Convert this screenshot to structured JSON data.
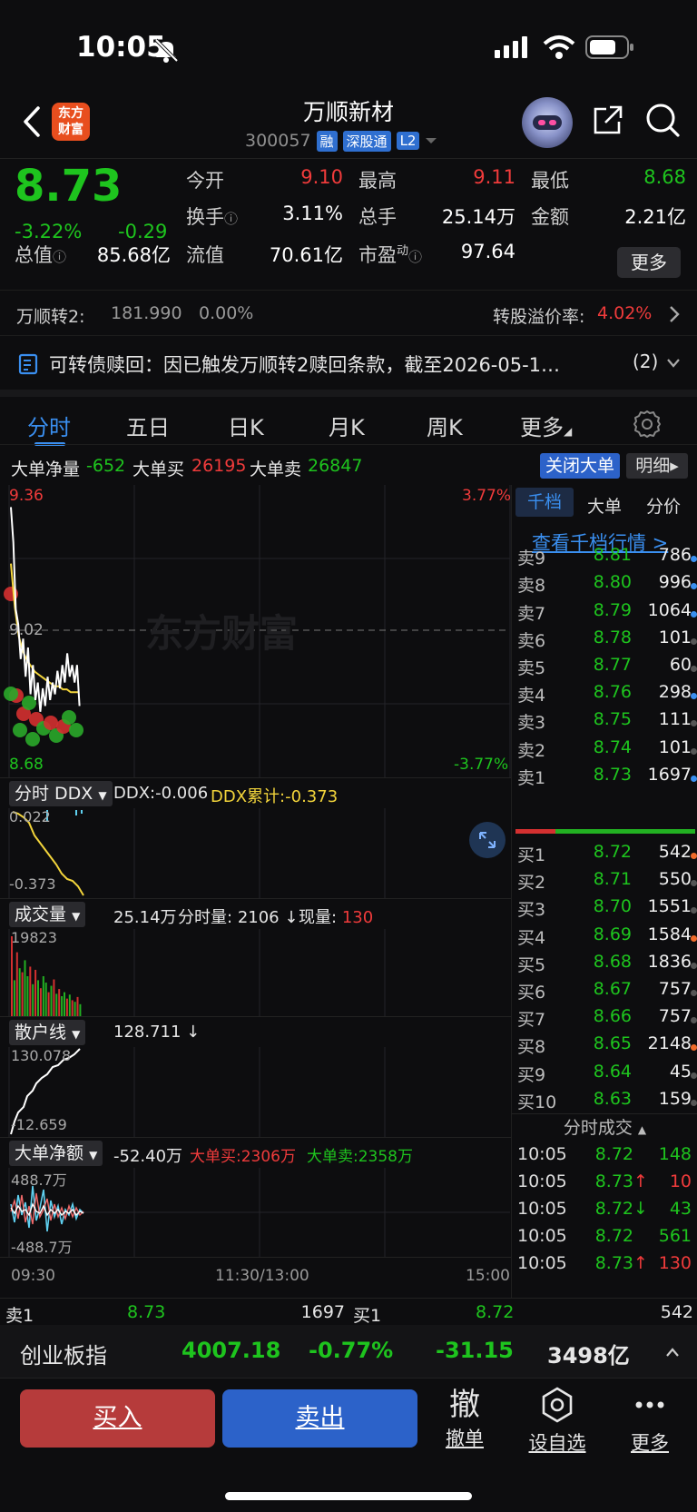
{
  "status": {
    "time": "10:05"
  },
  "header": {
    "logo_top": "东方",
    "logo_bottom": "财富",
    "title": "万顺新材",
    "code": "300057",
    "tags": [
      "融",
      "深股通",
      "L2"
    ]
  },
  "quote": {
    "price": "8.73",
    "pct": "-3.22%",
    "change": "-0.29",
    "fields": {
      "open_label": "今开",
      "open": "9.10",
      "high_label": "最高",
      "high": "9.11",
      "low_label": "最低",
      "low": "8.68",
      "turnover_label": "换手",
      "turnover": "3.11%",
      "vol_label": "总手",
      "vol": "25.14万",
      "amount_label": "金额",
      "amount": "2.21亿",
      "mcap_label": "总值",
      "mcap": "85.68亿",
      "float_label": "流值",
      "float": "70.61亿",
      "pe_label": "市盈",
      "pe_sup": "动",
      "pe": "97.64"
    },
    "more": "更多"
  },
  "convertible": {
    "name": "万顺转2:",
    "price": "181.990",
    "pct": "0.00%",
    "premium_label": "转股溢价率:",
    "premium": "4.02%"
  },
  "notice": {
    "text": "可转债赎回：因已触发万顺转2赎回条款，截至2026-05-1…",
    "count": "(2)"
  },
  "tabs": [
    "分时",
    "五日",
    "日K",
    "月K",
    "周K",
    "更多"
  ],
  "bigorder": {
    "net_label": "大单净量",
    "net": "-652",
    "buy_label": "大单买",
    "buy": "26195",
    "sell_label": "大单卖",
    "sell": "26847",
    "close_btn": "关闭大单",
    "detail_btn": "明细"
  },
  "main_chart": {
    "top_price": "9.36",
    "top_pct": "3.77%",
    "mid_price": "9.02",
    "bottom_price": "8.68",
    "bottom_pct": "-3.77%",
    "watermark": "东方财富",
    "price_line": [
      0.2,
      0.32,
      0.55,
      0.6,
      0.72,
      0.65,
      0.78,
      0.68,
      0.84,
      0.74,
      0.86,
      0.8,
      0.9,
      0.82,
      0.88,
      0.78,
      0.86,
      0.8,
      0.84,
      0.76,
      0.82,
      0.74,
      0.8,
      0.7,
      0.78,
      0.74,
      0.8,
      0.74,
      0.88
    ],
    "avg_line": [
      0.3,
      0.45,
      0.55,
      0.6,
      0.63,
      0.65,
      0.67,
      0.68,
      0.69,
      0.7,
      0.71,
      0.72,
      0.72,
      0.73,
      0.73,
      0.74,
      0.74,
      0.74
    ]
  },
  "ddx": {
    "selector": "分时 DDX",
    "ddx_label": "DDX:",
    "ddx": "-0.006",
    "cum_label": "DDX累计:",
    "cum": "-0.373",
    "top": "0.022",
    "bottom": "-0.373"
  },
  "volume": {
    "selector": "成交量",
    "total": "25.14万",
    "minute_label": "分时量:",
    "minute": "2106",
    "now_label": "现量:",
    "now": "130",
    "max": "19823",
    "bars": [
      1.0,
      0.45,
      0.8,
      0.6,
      0.55,
      0.7,
      0.5,
      0.62,
      0.4,
      0.58,
      0.45,
      0.35,
      0.5,
      0.42,
      0.3,
      0.38,
      0.46,
      0.28,
      0.34,
      0.25,
      0.3,
      0.22,
      0.27,
      0.2,
      0.18,
      0.24,
      0.15
    ],
    "bar_colors": [
      "r",
      "g",
      "r",
      "g",
      "r",
      "g",
      "g",
      "r",
      "g",
      "r",
      "g",
      "r",
      "g",
      "g",
      "r",
      "g",
      "r",
      "g",
      "r",
      "g",
      "g",
      "r",
      "g",
      "r",
      "g",
      "r",
      "g"
    ]
  },
  "retail": {
    "selector": "散户线",
    "value": "128.711",
    "top": "130.078",
    "bottom": "-12.659"
  },
  "bignet": {
    "selector": "大单净额",
    "value": "-52.40万",
    "buy_label": "大单买:",
    "buy": "2306万",
    "sell_label": "大单卖:",
    "sell": "2358万",
    "top": "488.7万",
    "bottom": "-488.7万"
  },
  "time_axis": [
    "09:30",
    "11:30/13:00",
    "15:00"
  ],
  "book": {
    "tabs": [
      "千档",
      "大单",
      "分价"
    ],
    "link": "查看千档行情 >",
    "asks": [
      {
        "label": "卖9",
        "price": "8.81",
        "vol": "786",
        "dot": "blue"
      },
      {
        "label": "卖8",
        "price": "8.80",
        "vol": "996",
        "dot": "blue"
      },
      {
        "label": "卖7",
        "price": "8.79",
        "vol": "1064",
        "dot": "blue"
      },
      {
        "label": "卖6",
        "price": "8.78",
        "vol": "101",
        "dot": "gray"
      },
      {
        "label": "卖5",
        "price": "8.77",
        "vol": "60",
        "dot": "gray"
      },
      {
        "label": "卖4",
        "price": "8.76",
        "vol": "298",
        "dot": "blue"
      },
      {
        "label": "卖3",
        "price": "8.75",
        "vol": "111",
        "dot": "gray"
      },
      {
        "label": "卖2",
        "price": "8.74",
        "vol": "101",
        "dot": "gray"
      },
      {
        "label": "卖1",
        "price": "8.73",
        "vol": "1697",
        "dot": "blue"
      }
    ],
    "bids": [
      {
        "label": "买1",
        "price": "8.72",
        "vol": "542",
        "dot": "orange"
      },
      {
        "label": "买2",
        "price": "8.71",
        "vol": "550",
        "dot": "gray"
      },
      {
        "label": "买3",
        "price": "8.70",
        "vol": "1551",
        "dot": "gray"
      },
      {
        "label": "买4",
        "price": "8.69",
        "vol": "1584",
        "dot": "orange"
      },
      {
        "label": "买5",
        "price": "8.68",
        "vol": "1836",
        "dot": "gray"
      },
      {
        "label": "买6",
        "price": "8.67",
        "vol": "757",
        "dot": "gray"
      },
      {
        "label": "买7",
        "price": "8.66",
        "vol": "757",
        "dot": "gray"
      },
      {
        "label": "买8",
        "price": "8.65",
        "vol": "2148",
        "dot": "orange"
      },
      {
        "label": "买9",
        "price": "8.64",
        "vol": "45",
        "dot": "gray"
      },
      {
        "label": "买10",
        "price": "8.63",
        "vol": "159",
        "dot": "gray"
      }
    ],
    "trades_title": "分时成交",
    "trades": [
      {
        "time": "10:05",
        "price": "8.72",
        "arrow": "",
        "vol": "148",
        "vcolor": "green"
      },
      {
        "time": "10:05",
        "price": "8.73",
        "arrow": "↑",
        "vol": "10",
        "vcolor": "red"
      },
      {
        "time": "10:05",
        "price": "8.72",
        "arrow": "↓",
        "vol": "43",
        "vcolor": "green"
      },
      {
        "time": "10:05",
        "price": "8.72",
        "arrow": "",
        "vol": "561",
        "vcolor": "green"
      },
      {
        "time": "10:05",
        "price": "8.73",
        "arrow": "↑",
        "vol": "130",
        "vcolor": "red"
      }
    ]
  },
  "best": {
    "ask_label": "卖1",
    "ask_price": "8.73",
    "ask_vol": "1697",
    "bid_label": "买1",
    "bid_price": "8.72",
    "bid_vol": "542"
  },
  "index": {
    "name": "创业板指",
    "value": "4007.18",
    "pct": "-0.77%",
    "change": "-31.15",
    "amount": "3498亿"
  },
  "actions": {
    "buy": "买入",
    "sell": "卖出",
    "cancel_glyph": "撤",
    "cancel": "撤单",
    "watch": "设自选",
    "more": "更多"
  },
  "colors": {
    "up": "#f03b3b",
    "down": "#1ec41e",
    "accent": "#3a8ff0",
    "bg": "#0d0d0f"
  }
}
